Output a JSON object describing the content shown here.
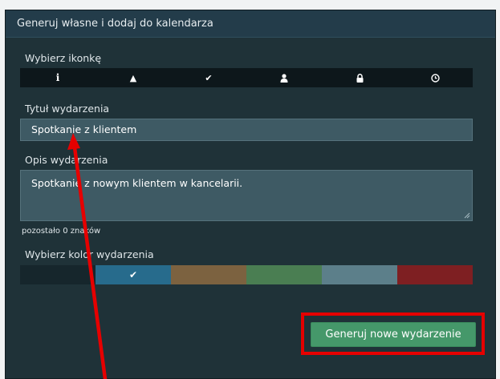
{
  "panel": {
    "title": "Generuj własne i dodaj do kalendarza"
  },
  "icon_picker": {
    "label": "Wybierz ikonkę",
    "icons": [
      "info-icon",
      "warning-icon",
      "check-icon",
      "user-icon",
      "lock-icon",
      "clock-icon"
    ],
    "glyphs": [
      "i",
      "▲",
      "✔",
      "",
      "",
      ""
    ],
    "selected_index": 0
  },
  "event_title": {
    "label": "Tytuł wydarzenia",
    "value": "Spotkanie z klientem"
  },
  "event_description": {
    "label": "Opis wydarzenia",
    "value": "Spotkanie z nowym klientem w kancelarii."
  },
  "char_counter": {
    "text": "pozostało 0 znaków"
  },
  "color_picker": {
    "label": "Wybierz kolor wydarzenia",
    "colors": [
      "#16262c",
      "#276b8c",
      "#7c6240",
      "#4a7e52",
      "#5c7f8a",
      "#7e1f22"
    ],
    "selected_index": 1,
    "selected_mark": "✔"
  },
  "generate_button": {
    "label": "Generuj nowe wydarzenie"
  },
  "annotation": {
    "arrow_color": "#e60000",
    "highlight_color": "#e60000"
  }
}
